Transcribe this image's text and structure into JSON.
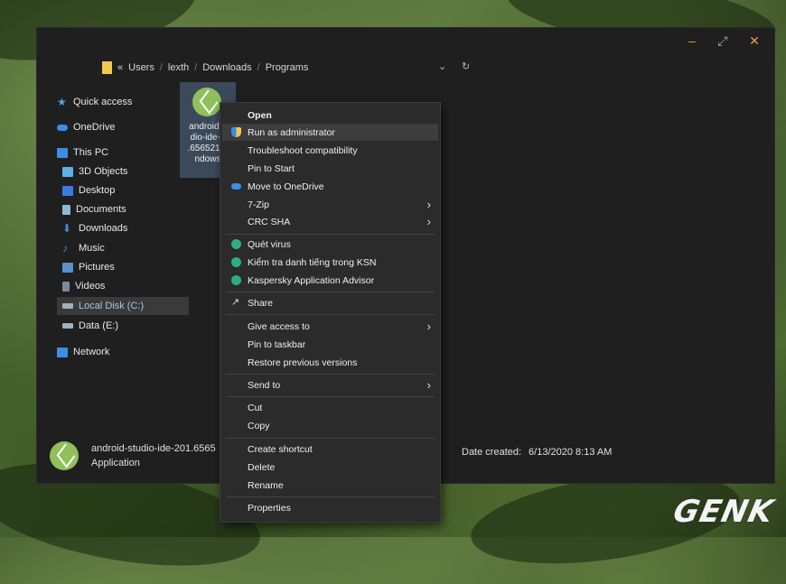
{
  "window": {
    "controls": {
      "minimize": "–",
      "maximize": "⤢",
      "close": "✕"
    }
  },
  "address_bar": {
    "prefix": "«",
    "path": [
      "Users",
      "lexth",
      "Downloads",
      "Programs"
    ],
    "separator": "/"
  },
  "nav": {
    "items": [
      {
        "label": "Quick access",
        "icon": "star-icon"
      },
      {
        "label": "OneDrive",
        "icon": "cloud-icon"
      },
      {
        "label": "This PC",
        "icon": "computer-icon"
      },
      {
        "label": "3D Objects",
        "icon": "cube-icon"
      },
      {
        "label": "Desktop",
        "icon": "desktop-icon"
      },
      {
        "label": "Documents",
        "icon": "document-icon"
      },
      {
        "label": "Downloads",
        "icon": "download-icon"
      },
      {
        "label": "Music",
        "icon": "music-icon"
      },
      {
        "label": "Pictures",
        "icon": "picture-icon"
      },
      {
        "label": "Videos",
        "icon": "video-icon"
      },
      {
        "label": "Local Disk (C:)",
        "icon": "drive-icon"
      },
      {
        "label": "Data (E:)",
        "icon": "drive-icon"
      },
      {
        "label": "Network",
        "icon": "network-icon"
      }
    ],
    "selected": "Local Disk (C:)"
  },
  "file": {
    "name_lines": "android-s\ndio-ide-2\n.6565218-\nndows",
    "icon": "android-studio-icon"
  },
  "status": {
    "name": "android-studio-ide-201.6565",
    "type": "Application",
    "date_label": "Date created:",
    "date_value": "6/13/2020 8:13 AM"
  },
  "context_menu": {
    "items": [
      {
        "label": "Open",
        "bold": true
      },
      {
        "label": "Run as administrator",
        "icon": "uac-shield-icon"
      },
      {
        "label": "Troubleshoot compatibility"
      },
      {
        "label": "Pin to Start"
      },
      {
        "label": "Move to OneDrive",
        "icon": "cloud-icon"
      },
      {
        "label": "7-Zip",
        "submenu": true
      },
      {
        "label": "CRC SHA",
        "submenu": true
      },
      {
        "label": "Quét virus",
        "icon": "kaspersky-icon"
      },
      {
        "label": "Kiểm tra danh tiếng trong KSN",
        "icon": "kaspersky-icon"
      },
      {
        "label": "Kaspersky Application Advisor",
        "icon": "kaspersky-icon"
      },
      {
        "label": "Share",
        "icon": "share-icon"
      },
      {
        "label": "Give access to",
        "submenu": true
      },
      {
        "label": "Pin to taskbar"
      },
      {
        "label": "Restore previous versions"
      },
      {
        "label": "Send to",
        "submenu": true
      },
      {
        "label": "Cut"
      },
      {
        "label": "Copy"
      },
      {
        "label": "Create shortcut"
      },
      {
        "label": "Delete"
      },
      {
        "label": "Rename"
      },
      {
        "label": "Properties"
      }
    ],
    "highlighted": "Run as administrator",
    "submenu_arrow": "›"
  },
  "watermark": "GENK",
  "colors": {
    "accent": "#e8a23b",
    "selection": "#3b4a5a",
    "menu_bg": "#2b2b2b"
  }
}
